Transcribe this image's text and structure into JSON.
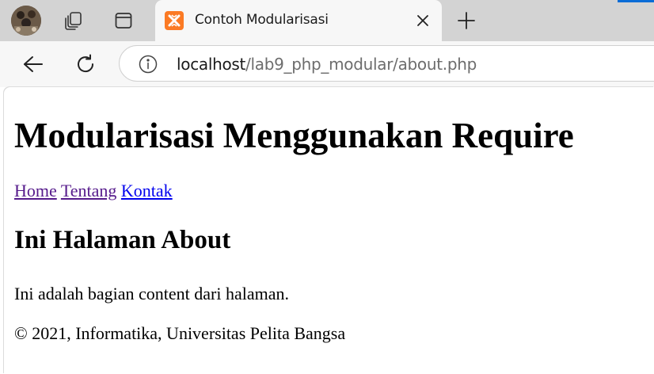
{
  "browser": {
    "tab": {
      "title": "Contoh Modularisasi",
      "favicon": "xampp-logo-icon"
    },
    "address": {
      "host": "localhost",
      "path": "/lab9_php_modular/about.php"
    },
    "icons": {
      "profile": "avatar",
      "workspaces": "workspaces-icon",
      "tab_actions": "vertical-tabs-icon",
      "close": "close-icon",
      "new_tab": "plus-icon",
      "back": "back-arrow-icon",
      "refresh": "refresh-icon",
      "site_info": "info-icon"
    },
    "colors": {
      "tabstrip": "#d3d3d3",
      "toolbar": "#f7f7f7",
      "favicon": "#fb7a24"
    }
  },
  "page": {
    "heading": "Modularisasi Menggunakan Require",
    "nav": [
      {
        "label": "Home",
        "visited": true
      },
      {
        "label": "Tentang",
        "visited": true
      },
      {
        "label": "Kontak",
        "visited": false
      }
    ],
    "subheading": "Ini Halaman About",
    "content": "Ini adalah bagian content dari halaman.",
    "footer": "© 2021, Informatika, Universitas Pelita Bangsa",
    "colors": {
      "link_visited": "#551a8b",
      "link_unvisited": "#0000ee"
    }
  }
}
